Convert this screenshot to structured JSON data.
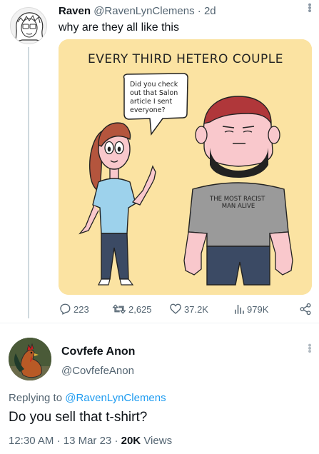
{
  "tweet": {
    "author_name": "Raven",
    "author_handle": "@RavenLynClemens",
    "separator": "·",
    "age": "2d",
    "text": "why are they all like this",
    "more_icon": "more-options-icon",
    "comic": {
      "title": "EVERY THIRD HETERO COUPLE",
      "speech_lines": [
        "Did you check",
        "out that Salon",
        "article I sent",
        "everyone?"
      ],
      "shirt_lines": [
        "THE MOST RACIST",
        "MAN ALIVE"
      ],
      "colors": {
        "background": "#fbe3a2",
        "skin": "#f9c8cc",
        "woman_shirt": "#9dd2ec",
        "pants": "#3b4a64",
        "man_shirt": "#9a9a9a",
        "hair_woman": "#b4553d",
        "hair_man": "#b0373a"
      }
    },
    "actions": {
      "replies": "223",
      "retweets": "2,625",
      "likes": "37.2K",
      "views": "979K"
    }
  },
  "reply_tweet": {
    "author_name": "Covfefe Anon",
    "author_handle": "@CovfefeAnon",
    "replying_label": "Replying to",
    "replying_to": "@RavenLynClemens",
    "text": "Do you sell that t-shirt?",
    "time": "12:30 AM",
    "date": "13 Mar 23",
    "views_count": "20K",
    "views_label": "Views",
    "separator": "·"
  }
}
